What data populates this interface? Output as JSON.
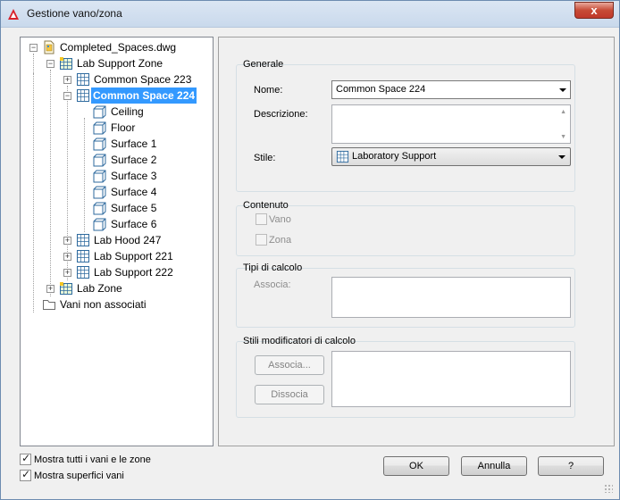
{
  "window": {
    "title": "Gestione vano/zona",
    "close_glyph": "x",
    "app_icon": "autocad-logo-icon"
  },
  "tree": {
    "nodes": [
      {
        "label": "Completed_Spaces.dwg",
        "icon": "dwg-file-icon",
        "expander": "−",
        "level": 0
      },
      {
        "label": "Lab Support Zone",
        "icon": "zone-grid-icon",
        "expander": "−",
        "level": 1
      },
      {
        "label": "Common Space 223",
        "icon": "space-grid-icon",
        "expander": "+",
        "level": 2
      },
      {
        "label": "Common Space 224",
        "icon": "space-grid-icon",
        "expander": "−",
        "level": 2,
        "selected": true
      },
      {
        "label": "Ceiling",
        "icon": "surface-icon",
        "level": 3
      },
      {
        "label": "Floor",
        "icon": "surface-icon",
        "level": 3
      },
      {
        "label": "Surface 1",
        "icon": "surface-icon",
        "level": 3
      },
      {
        "label": "Surface 2",
        "icon": "surface-icon",
        "level": 3
      },
      {
        "label": "Surface 3",
        "icon": "surface-icon",
        "level": 3
      },
      {
        "label": "Surface 4",
        "icon": "surface-icon",
        "level": 3
      },
      {
        "label": "Surface 5",
        "icon": "surface-icon",
        "level": 3
      },
      {
        "label": "Surface 6",
        "icon": "surface-icon",
        "level": 3
      },
      {
        "label": "Lab Hood 247",
        "icon": "space-grid-icon",
        "expander": "+",
        "level": 2
      },
      {
        "label": "Lab Support 221",
        "icon": "space-grid-icon",
        "expander": "+",
        "level": 2
      },
      {
        "label": "Lab Support 222",
        "icon": "space-grid-icon",
        "expander": "+",
        "level": 2
      },
      {
        "label": "Lab Zone",
        "icon": "zone-grid-icon",
        "expander": "+",
        "level": 1
      },
      {
        "label": "Vani non associati",
        "icon": "folder-icon",
        "level": 1
      }
    ]
  },
  "generale": {
    "title": "Generale",
    "name_label": "Nome:",
    "name_value": "Common Space 224",
    "desc_label": "Descrizione:",
    "desc_value": "",
    "style_label": "Stile:",
    "style_value": "Laboratory Support"
  },
  "contenuto": {
    "title": "Contenuto",
    "vano_label": "Vano",
    "zona_label": "Zona"
  },
  "calcolo": {
    "title": "Tipi di calcolo",
    "associa_label": "Associa:"
  },
  "modificatori": {
    "title": "Stili modificatori di calcolo",
    "associa_button": "Associa...",
    "dissocia_button": "Dissocia"
  },
  "options": {
    "show_all_label": "Mostra tutti i vani e le zone",
    "show_all_checked": true,
    "show_surfaces_label": "Mostra superfici vani",
    "show_surfaces_checked": true
  },
  "buttons": {
    "ok": "OK",
    "cancel": "Annulla",
    "help": "?"
  },
  "colors": {
    "selection": "#3399ff",
    "title_bar": "#c9d9ec",
    "close_button": "#c74b36"
  }
}
